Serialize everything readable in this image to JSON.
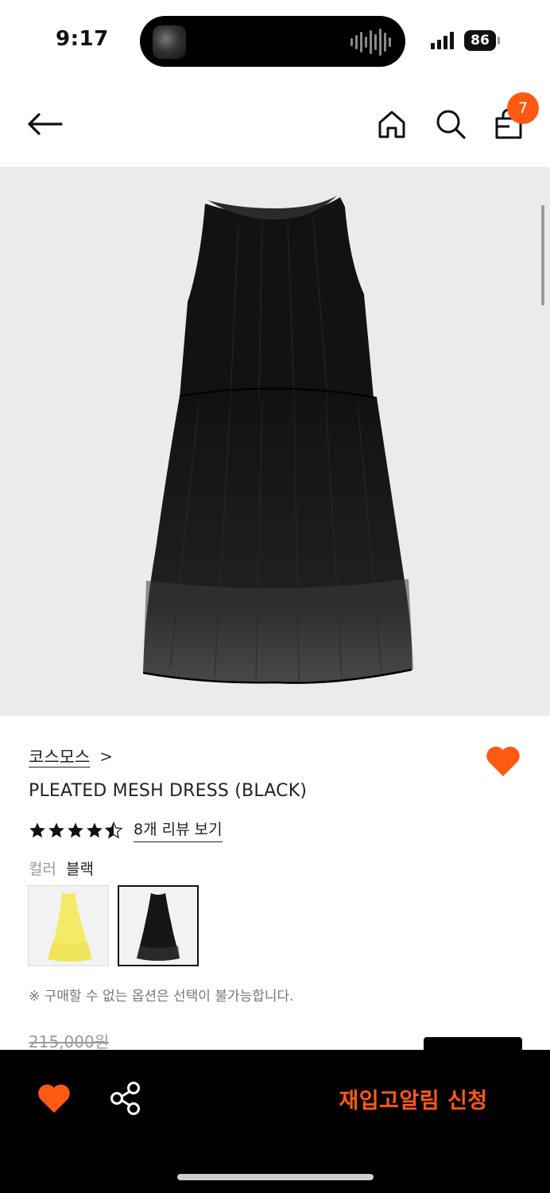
{
  "status_bar": {
    "time": "9:17",
    "battery": "86"
  },
  "header": {
    "cart_count": "7",
    "icons": [
      "back-arrow-icon",
      "home-icon",
      "search-icon",
      "shopping-bag-icon"
    ]
  },
  "product": {
    "brand": "코스모스",
    "brand_chevron": ">",
    "title": "PLEATED MESH DRESS (BLACK)",
    "rating": 4.5,
    "rating_max": 5,
    "review_link": "8개 리뷰 보기",
    "color_label": "컬러",
    "color_value": "블랙",
    "swatches": [
      {
        "name": "yellow",
        "selected": false
      },
      {
        "name": "black",
        "selected": true
      }
    ],
    "notice": "※ 구매할 수 없는 옵션은 선택이 불가능합니다.",
    "original_price": "215,000원",
    "wishlisted": true
  },
  "bottom_bar": {
    "restock_label": "재입고알림 신청"
  },
  "colors": {
    "accent": "#ff5a14",
    "image_bg": "#ebebee",
    "bottom_bar": "#000000"
  }
}
